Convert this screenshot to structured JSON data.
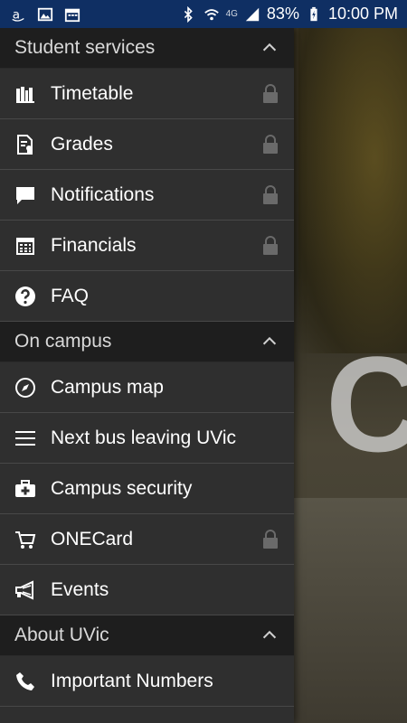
{
  "status_bar": {
    "battery": "83%",
    "time": "10:00 PM",
    "network": "4G"
  },
  "background": {
    "letter": "C"
  },
  "sections": [
    {
      "title": "Student services",
      "items": [
        {
          "label": "Timetable",
          "icon": "timetable-icon",
          "locked": true
        },
        {
          "label": "Grades",
          "icon": "grades-icon",
          "locked": true
        },
        {
          "label": "Notifications",
          "icon": "chat-bubble-icon",
          "locked": true
        },
        {
          "label": "Financials",
          "icon": "calculator-icon",
          "locked": true
        },
        {
          "label": "FAQ",
          "icon": "help-icon",
          "locked": false
        }
      ]
    },
    {
      "title": "On campus",
      "items": [
        {
          "label": "Campus map",
          "icon": "compass-icon",
          "locked": false
        },
        {
          "label": "Next bus leaving UVic",
          "icon": "menu-lines-icon",
          "locked": false
        },
        {
          "label": "Campus security",
          "icon": "first-aid-kit-icon",
          "locked": false
        },
        {
          "label": "ONECard",
          "icon": "cart-icon",
          "locked": true
        },
        {
          "label": "Events",
          "icon": "megaphone-icon",
          "locked": false
        }
      ]
    },
    {
      "title": "About UVic",
      "items": [
        {
          "label": "Important Numbers",
          "icon": "phone-icon",
          "locked": false
        }
      ]
    }
  ],
  "colors": {
    "status_bar": "#0f2f63",
    "drawer_bg": "#2f2f2f",
    "section_bg": "#1e1e1e",
    "text": "#ffffff",
    "lock": "#6a6a6a"
  }
}
